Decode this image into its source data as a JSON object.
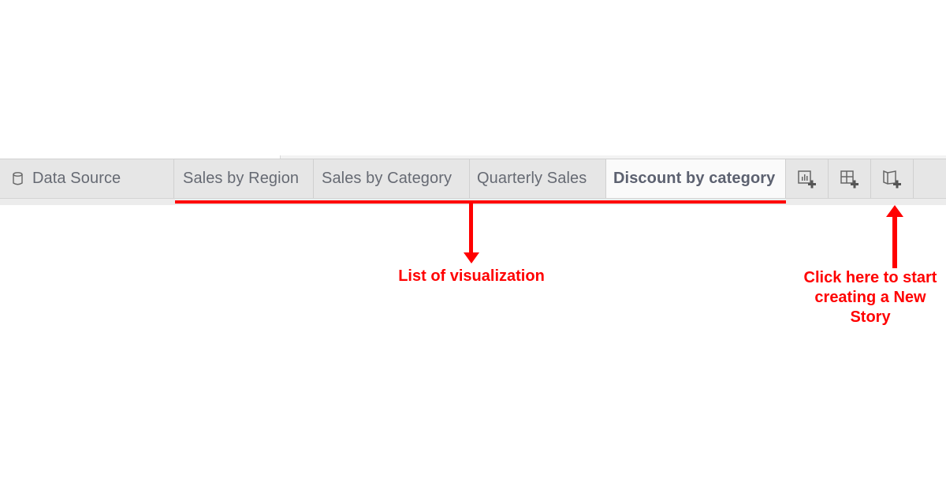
{
  "tabbar": {
    "data_source_tab": {
      "label": "Data Source",
      "icon": "database-icon"
    },
    "sheet_tabs": [
      {
        "label": "Sales by Region",
        "active": false
      },
      {
        "label": "Sales by Category",
        "active": false
      },
      {
        "label": "Quarterly Sales",
        "active": false
      },
      {
        "label": "Discount by category",
        "active": true
      }
    ],
    "icon_buttons": [
      {
        "name": "new-worksheet",
        "icon": "new-worksheet-icon"
      },
      {
        "name": "new-dashboard",
        "icon": "new-dashboard-icon"
      },
      {
        "name": "new-story",
        "icon": "new-story-icon"
      }
    ]
  },
  "annotations": {
    "list_callout": "List of visualization",
    "story_callout_lines": [
      "Click here to start",
      "creating a New",
      "Story"
    ],
    "color": "#ff0000"
  },
  "colors": {
    "tabbar_bg": "#e6e6e6",
    "active_tab_bg": "#fafafa",
    "tab_text": "#666a73"
  }
}
